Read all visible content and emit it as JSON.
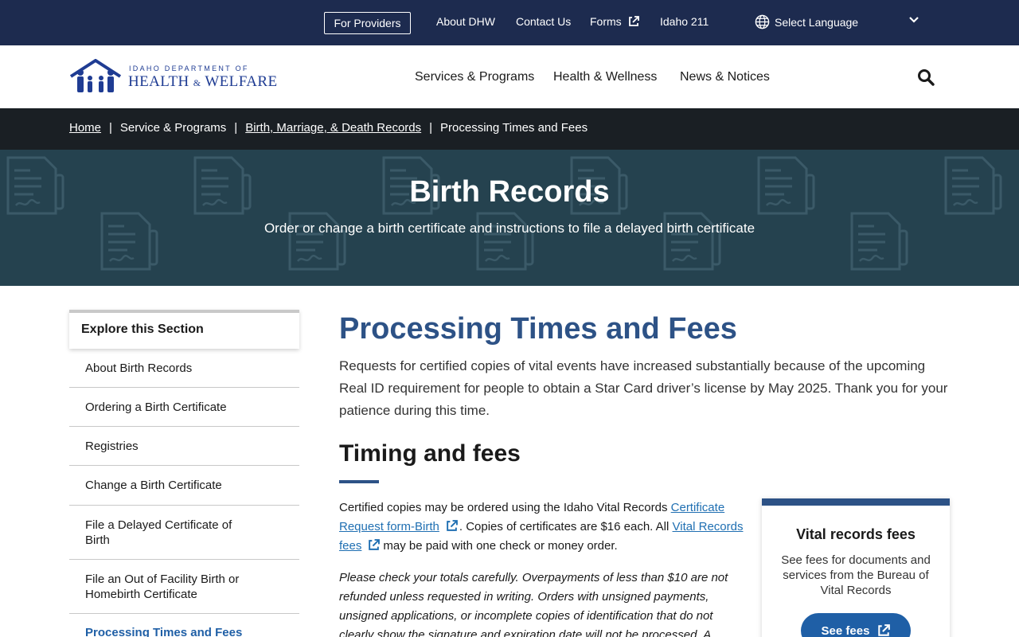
{
  "utility": {
    "providers_label": "For Providers",
    "about_label": "About DHW",
    "contact_label": "Contact Us",
    "forms_label": "Forms",
    "idaho211_label": "Idaho 211",
    "language_label": "Select Language"
  },
  "header": {
    "logo_top": "IDAHO DEPARTMENT OF",
    "logo_health": "HEALTH",
    "logo_amp": "&",
    "logo_welfare": "WELFARE",
    "nav": [
      "Services & Programs",
      "Health & Wellness",
      "News & Notices"
    ]
  },
  "breadcrumb": {
    "items": [
      "Home",
      "Service & Programs",
      "Birth, Marriage, & Death Records",
      "Processing Times and Fees"
    ],
    "separator": "|"
  },
  "hero": {
    "title": "Birth Records",
    "subtitle": "Order or change a birth certificate and instructions to file a delayed birth certificate"
  },
  "sidebar": {
    "heading": "Explore this Section",
    "items": [
      "About Birth Records",
      "Ordering a Birth Certificate",
      "Registries",
      "Change a Birth Certificate",
      "File a Delayed Certificate of Birth",
      "File an Out of Facility Birth or Homebirth Certificate",
      "Processing Times and Fees"
    ]
  },
  "main": {
    "title": "Processing Times and Fees",
    "intro": "Requests for certified copies of vital events have increased substantially because of the upcoming Real ID requirement for people to obtain a Star Card driver’s license by May 2025. Thank you for your patience during this time.",
    "section_title": "Timing and fees",
    "para_start": "Certified copies may be ordered using the Idaho Vital Records",
    "link_request_form": "Certificate Request form-Birth",
    "para_mid": ". Copies of certificates are $16 each. All",
    "link_fees": "Vital Records fees",
    "para_end": "may be paid with one check or money order.",
    "italic_para": "Please check your totals carefully. Overpayments of less than $10 are not refunded unless requested in writing. Orders with unsigned payments, unsigned applications, or incomplete copies of identification that do not clearly show the signature and expiration date will not be processed. A letter"
  },
  "fee_card": {
    "title": "Vital records fees",
    "text": "See fees for documents and services from the Bureau of Vital Records",
    "button": "See fees"
  },
  "colors": {
    "utility_bg": "#1d2b4f",
    "breadcrumb_bg": "#1a1f24",
    "hero_bg": "#25424f",
    "title_blue": "#2d5286",
    "link_blue": "#1f6fb2",
    "button_blue": "#1f5fa6"
  },
  "icons": [
    "external-link-icon",
    "globe-icon",
    "chevron-down-icon",
    "search-icon",
    "family-logo-icon",
    "document-pattern-icon"
  ]
}
